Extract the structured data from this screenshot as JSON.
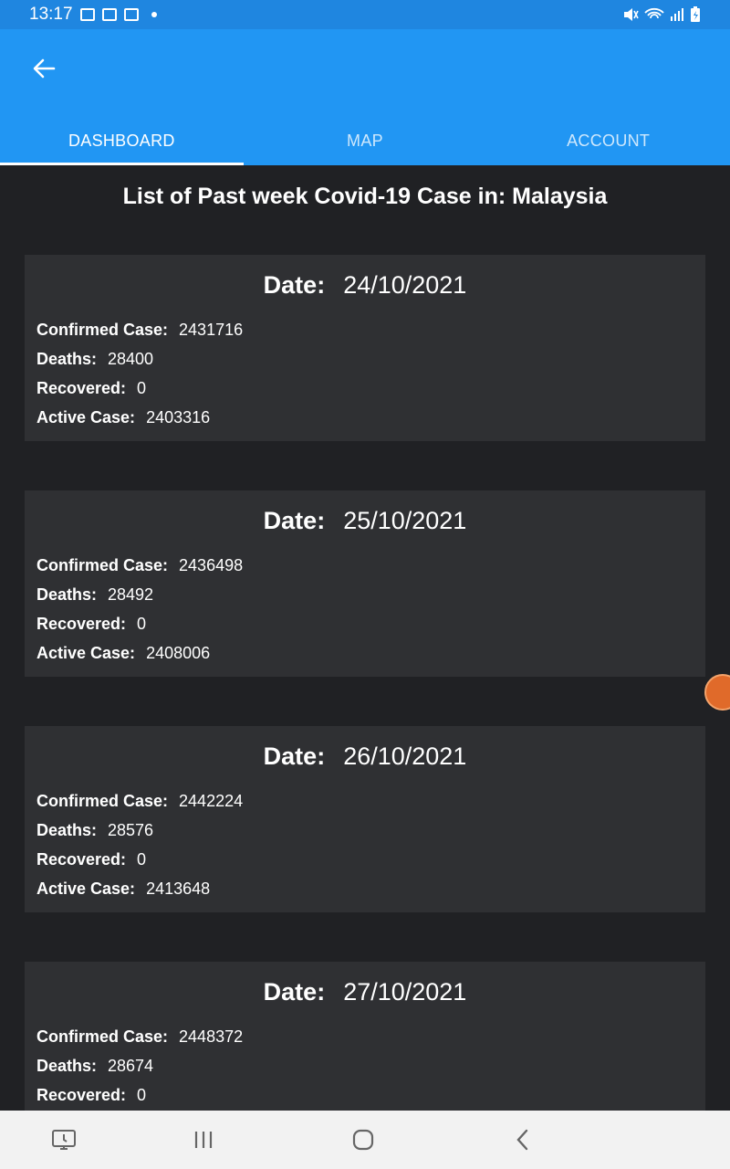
{
  "status_bar": {
    "time": "13:17"
  },
  "tabs": [
    {
      "label": "DASHBOARD"
    },
    {
      "label": "MAP"
    },
    {
      "label": "ACCOUNT"
    }
  ],
  "page_title": "List of Past week Covid-19 Case in: Malaysia",
  "labels": {
    "date": "Date:",
    "confirmed": "Confirmed Case:",
    "deaths": "Deaths:",
    "recovered": "Recovered:",
    "active": "Active Case:"
  },
  "cards": [
    {
      "date": "24/10/2021",
      "confirmed": "2431716",
      "deaths": "28400",
      "recovered": "0",
      "active": "2403316"
    },
    {
      "date": "25/10/2021",
      "confirmed": "2436498",
      "deaths": "28492",
      "recovered": "0",
      "active": "2408006"
    },
    {
      "date": "26/10/2021",
      "confirmed": "2442224",
      "deaths": "28576",
      "recovered": "0",
      "active": "2413648"
    },
    {
      "date": "27/10/2021",
      "confirmed": "2448372",
      "deaths": "28674",
      "recovered": "0",
      "active": ""
    }
  ],
  "colors": {
    "app_bar": "#2196f3",
    "status_bar": "#1f86e0",
    "background": "#202124",
    "card": "#2f3033"
  }
}
